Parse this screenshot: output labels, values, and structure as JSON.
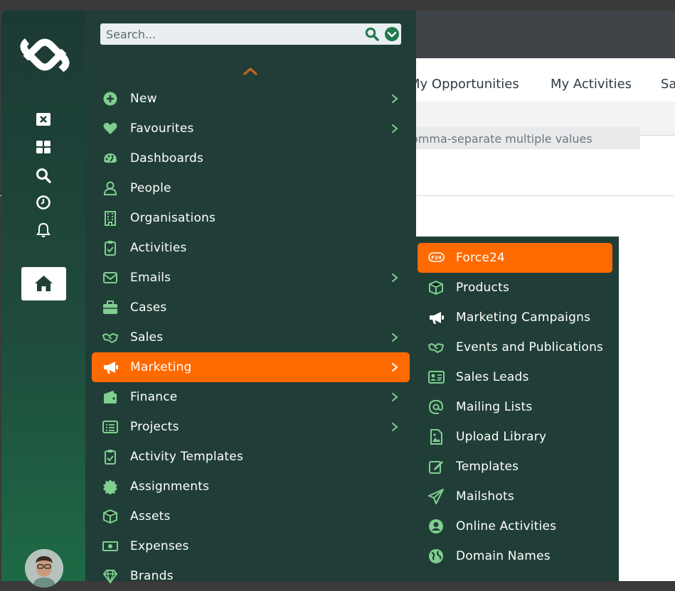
{
  "background_app": {
    "tabs": [
      "My Opportunities",
      "My Activities",
      "Sa"
    ],
    "filter_placeholder": "omma-separate multiple values"
  },
  "search": {
    "placeholder": "Search..."
  },
  "menu": {
    "items": [
      {
        "label": "New",
        "icon": "plus-circle-icon",
        "has_submenu": true
      },
      {
        "label": "Favourites",
        "icon": "heart-icon",
        "has_submenu": true
      },
      {
        "label": "Dashboards",
        "icon": "palette-icon",
        "has_submenu": false
      },
      {
        "label": "People",
        "icon": "person-icon",
        "has_submenu": false
      },
      {
        "label": "Organisations",
        "icon": "building-icon",
        "has_submenu": false
      },
      {
        "label": "Activities",
        "icon": "clipboard-icon",
        "has_submenu": false
      },
      {
        "label": "Emails",
        "icon": "envelope-icon",
        "has_submenu": true
      },
      {
        "label": "Cases",
        "icon": "briefcase-icon",
        "has_submenu": false
      },
      {
        "label": "Sales",
        "icon": "handshake-icon",
        "has_submenu": true
      },
      {
        "label": "Marketing",
        "icon": "megaphone-icon",
        "has_submenu": true,
        "active": true
      },
      {
        "label": "Finance",
        "icon": "wallet-icon",
        "has_submenu": true
      },
      {
        "label": "Projects",
        "icon": "list-icon",
        "has_submenu": true
      },
      {
        "label": "Activity Templates",
        "icon": "clipboard-icon",
        "has_submenu": false
      },
      {
        "label": "Assignments",
        "icon": "badge-icon",
        "has_submenu": false
      },
      {
        "label": "Assets",
        "icon": "box-icon",
        "has_submenu": false
      },
      {
        "label": "Expenses",
        "icon": "money-icon",
        "has_submenu": false
      },
      {
        "label": "Brands",
        "icon": "diamond-icon",
        "has_submenu": false
      }
    ]
  },
  "submenu": {
    "items": [
      {
        "label": "Force24",
        "icon": "f24-badge-icon",
        "active": true,
        "badge_text": "F24"
      },
      {
        "label": "Products",
        "icon": "box-icon"
      },
      {
        "label": "Marketing Campaigns",
        "icon": "megaphone-icon"
      },
      {
        "label": "Events and Publications",
        "icon": "handshake-icon"
      },
      {
        "label": "Sales Leads",
        "icon": "id-card-icon"
      },
      {
        "label": "Mailing Lists",
        "icon": "at-sign-icon"
      },
      {
        "label": "Upload Library",
        "icon": "file-image-icon"
      },
      {
        "label": "Templates",
        "icon": "edit-icon"
      },
      {
        "label": "Mailshots",
        "icon": "paper-plane-icon"
      },
      {
        "label": "Online Activities",
        "icon": "user-circle-icon"
      },
      {
        "label": "Domain Names",
        "icon": "globe-icon"
      }
    ]
  },
  "colors": {
    "rail_top": "#1b3a34",
    "rail_bottom": "#1e6a45",
    "menu_bg": "#203e37",
    "accent": "#ff6a00",
    "icon_green": "#7fcf8f",
    "search_icon": "#1f7a4c"
  }
}
